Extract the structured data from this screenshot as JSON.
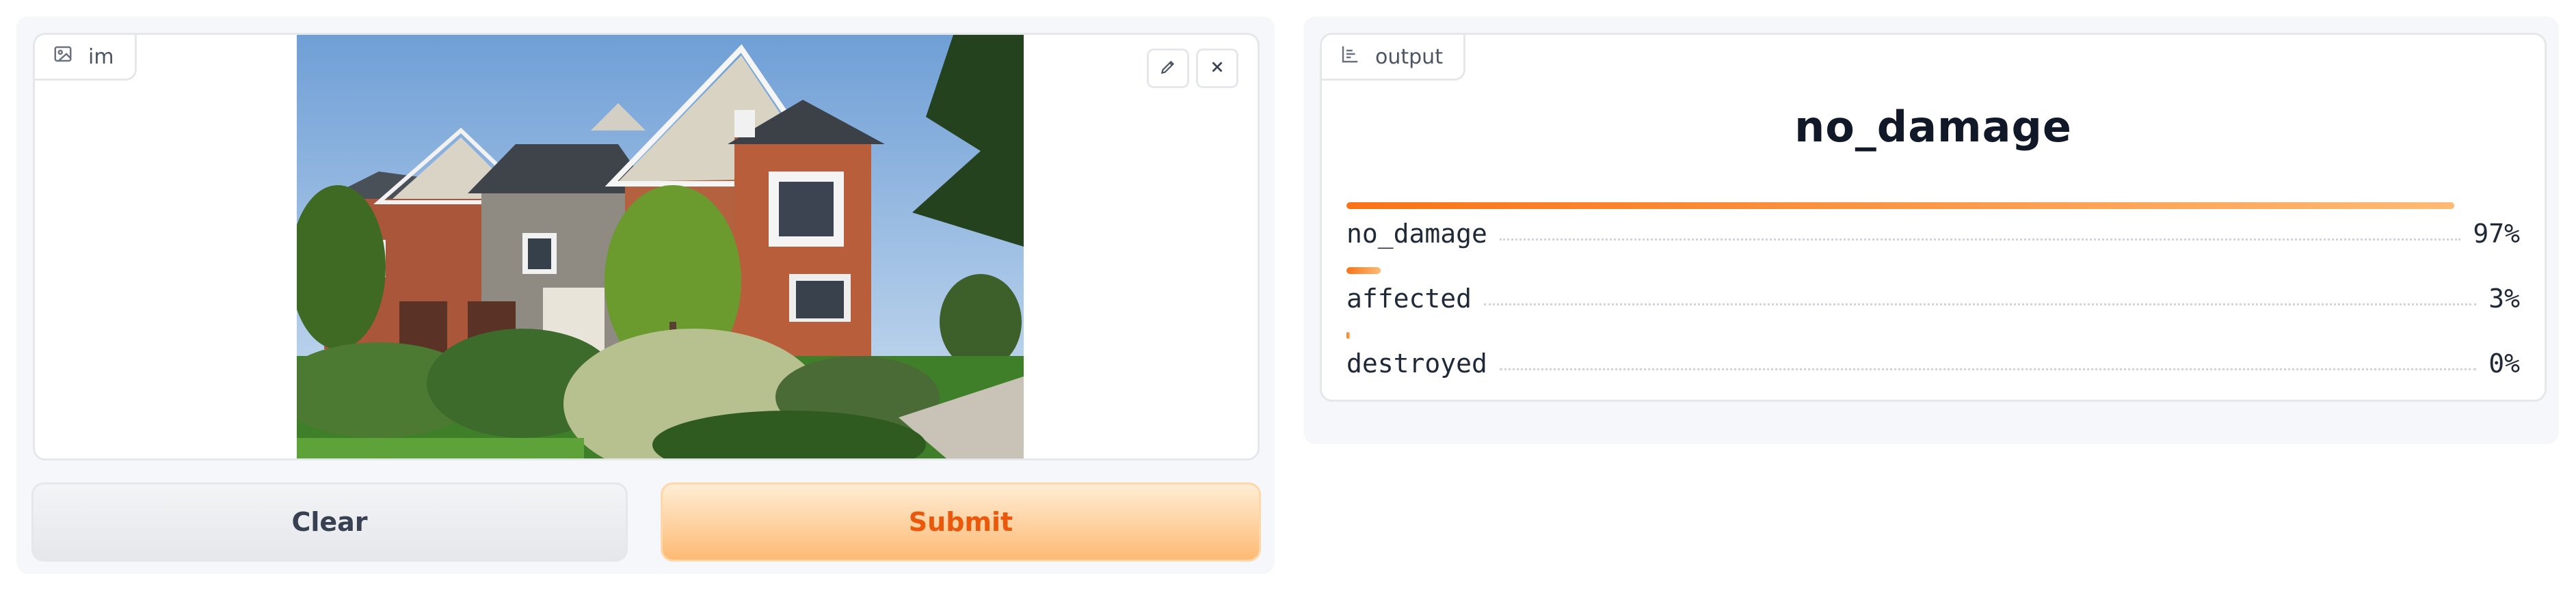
{
  "input_panel": {
    "label": "im",
    "label_icon": "image-icon",
    "image_alt": "photo of a brick townhouse row with landscaped shrubs and lawn",
    "tools": [
      "edit-icon",
      "close-icon"
    ]
  },
  "buttons": {
    "clear_label": "Clear",
    "submit_label": "Submit"
  },
  "output_panel": {
    "label": "output",
    "label_icon": "chart-icon",
    "top_label": "no_damage",
    "confidences": [
      {
        "label": "no_damage",
        "percent_text": "97%",
        "value": 0.97
      },
      {
        "label": "affected",
        "percent_text": "3%",
        "value": 0.03
      },
      {
        "label": "destroyed",
        "percent_text": "0%",
        "value": 0.003
      }
    ]
  },
  "colors": {
    "accent": "#f97316",
    "accent_light": "#fdba74",
    "submit_text": "#ea580c",
    "panel_bg": "#f5f7fa",
    "border": "#e5e7eb"
  }
}
